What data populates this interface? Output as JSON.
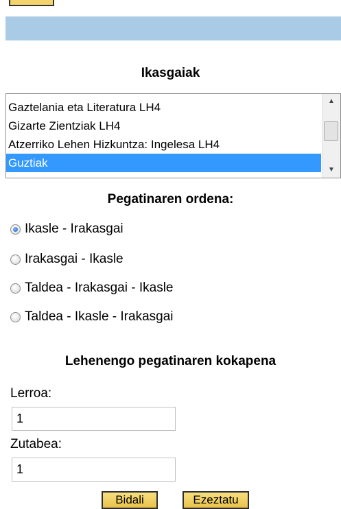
{
  "subjects": {
    "title": "Ikasgaiak",
    "items": [
      {
        "label": "Gaztelania eta Literatura LH4",
        "selected": false
      },
      {
        "label": "Gizarte Zientziak LH4",
        "selected": false
      },
      {
        "label": "Atzerriko Lehen Hizkuntza: Ingelesa LH4",
        "selected": false
      },
      {
        "label": "Guztiak",
        "selected": true
      }
    ]
  },
  "order": {
    "title": "Pegatinaren ordena:",
    "options": [
      {
        "label": "Ikasle - Irakasgai",
        "checked": true
      },
      {
        "label": "Irakasgai - Ikasle",
        "checked": false
      },
      {
        "label": "Taldea - Irakasgai - Ikasle",
        "checked": false
      },
      {
        "label": "Taldea - Ikasle - Irakasgai",
        "checked": false
      }
    ]
  },
  "position": {
    "title": "Lehenengo pegatinaren kokapena",
    "row_label": "Lerroa:",
    "row_value": "1",
    "column_label": "Zutabea:",
    "column_value": "1"
  },
  "buttons": {
    "submit": "Bidali",
    "cancel": "Ezeztatu"
  },
  "colors": {
    "banner": "#a9cbe6",
    "selection": "#3399ff",
    "button": "#e9c24a"
  }
}
